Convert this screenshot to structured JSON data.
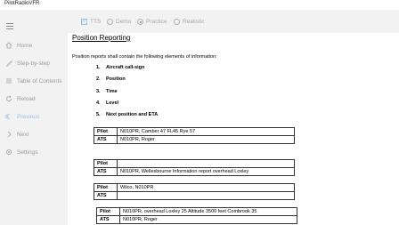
{
  "window": {
    "title": "PilotRadioVFR"
  },
  "sidebar": {
    "items": [
      {
        "label": "Home",
        "icon": "home-icon"
      },
      {
        "label": "Step-by-step",
        "icon": "steps-icon"
      },
      {
        "label": "Table of Contents",
        "icon": "list-icon"
      },
      {
        "label": "Reload",
        "icon": "reload-icon"
      },
      {
        "label": "Previous",
        "icon": "previous-icon"
      },
      {
        "label": "Next",
        "icon": "next-icon"
      },
      {
        "label": "Settings",
        "icon": "gear-icon"
      }
    ]
  },
  "toolbar": {
    "tts_label": "TTS",
    "tts_checked": true,
    "modes": [
      {
        "label": "Demo",
        "selected": false
      },
      {
        "label": "Practice",
        "selected": true
      },
      {
        "label": "Realistic",
        "selected": false
      }
    ]
  },
  "content": {
    "title": "Position Reporting",
    "intro": "Position reports shall contain the following elements of information:",
    "steps": [
      {
        "num": "1.",
        "text": "Aircraft call-sign"
      },
      {
        "num": "2.",
        "text": "Position"
      },
      {
        "num": "3.",
        "text": "Time"
      },
      {
        "num": "4.",
        "text": "Level"
      },
      {
        "num": "5.",
        "text": "Next position and ETA"
      }
    ],
    "dialogs": [
      {
        "rows": [
          {
            "who": "Pilot",
            "text": "N010PR, Camber 47 FL45 Rye 57"
          },
          {
            "who": "ATS",
            "text": "N010PR, Roger"
          }
        ]
      },
      {
        "rows": [
          {
            "who": "Pilot",
            "text": ""
          },
          {
            "who": "ATS",
            "text": "N010PR, Wellesbourne Information report overhead Loxley"
          }
        ]
      },
      {
        "rows": [
          {
            "who": "Pilot",
            "text": "Wilco, N010PR"
          },
          {
            "who": "ATS",
            "text": ""
          }
        ]
      },
      {
        "rows": [
          {
            "who": "Pilot",
            "text": "N010PR, overhead Loxley 25 Altitude 3500 feet Combrook 35"
          },
          {
            "who": "ATS",
            "text": "N010PR, Roger"
          }
        ]
      }
    ]
  }
}
